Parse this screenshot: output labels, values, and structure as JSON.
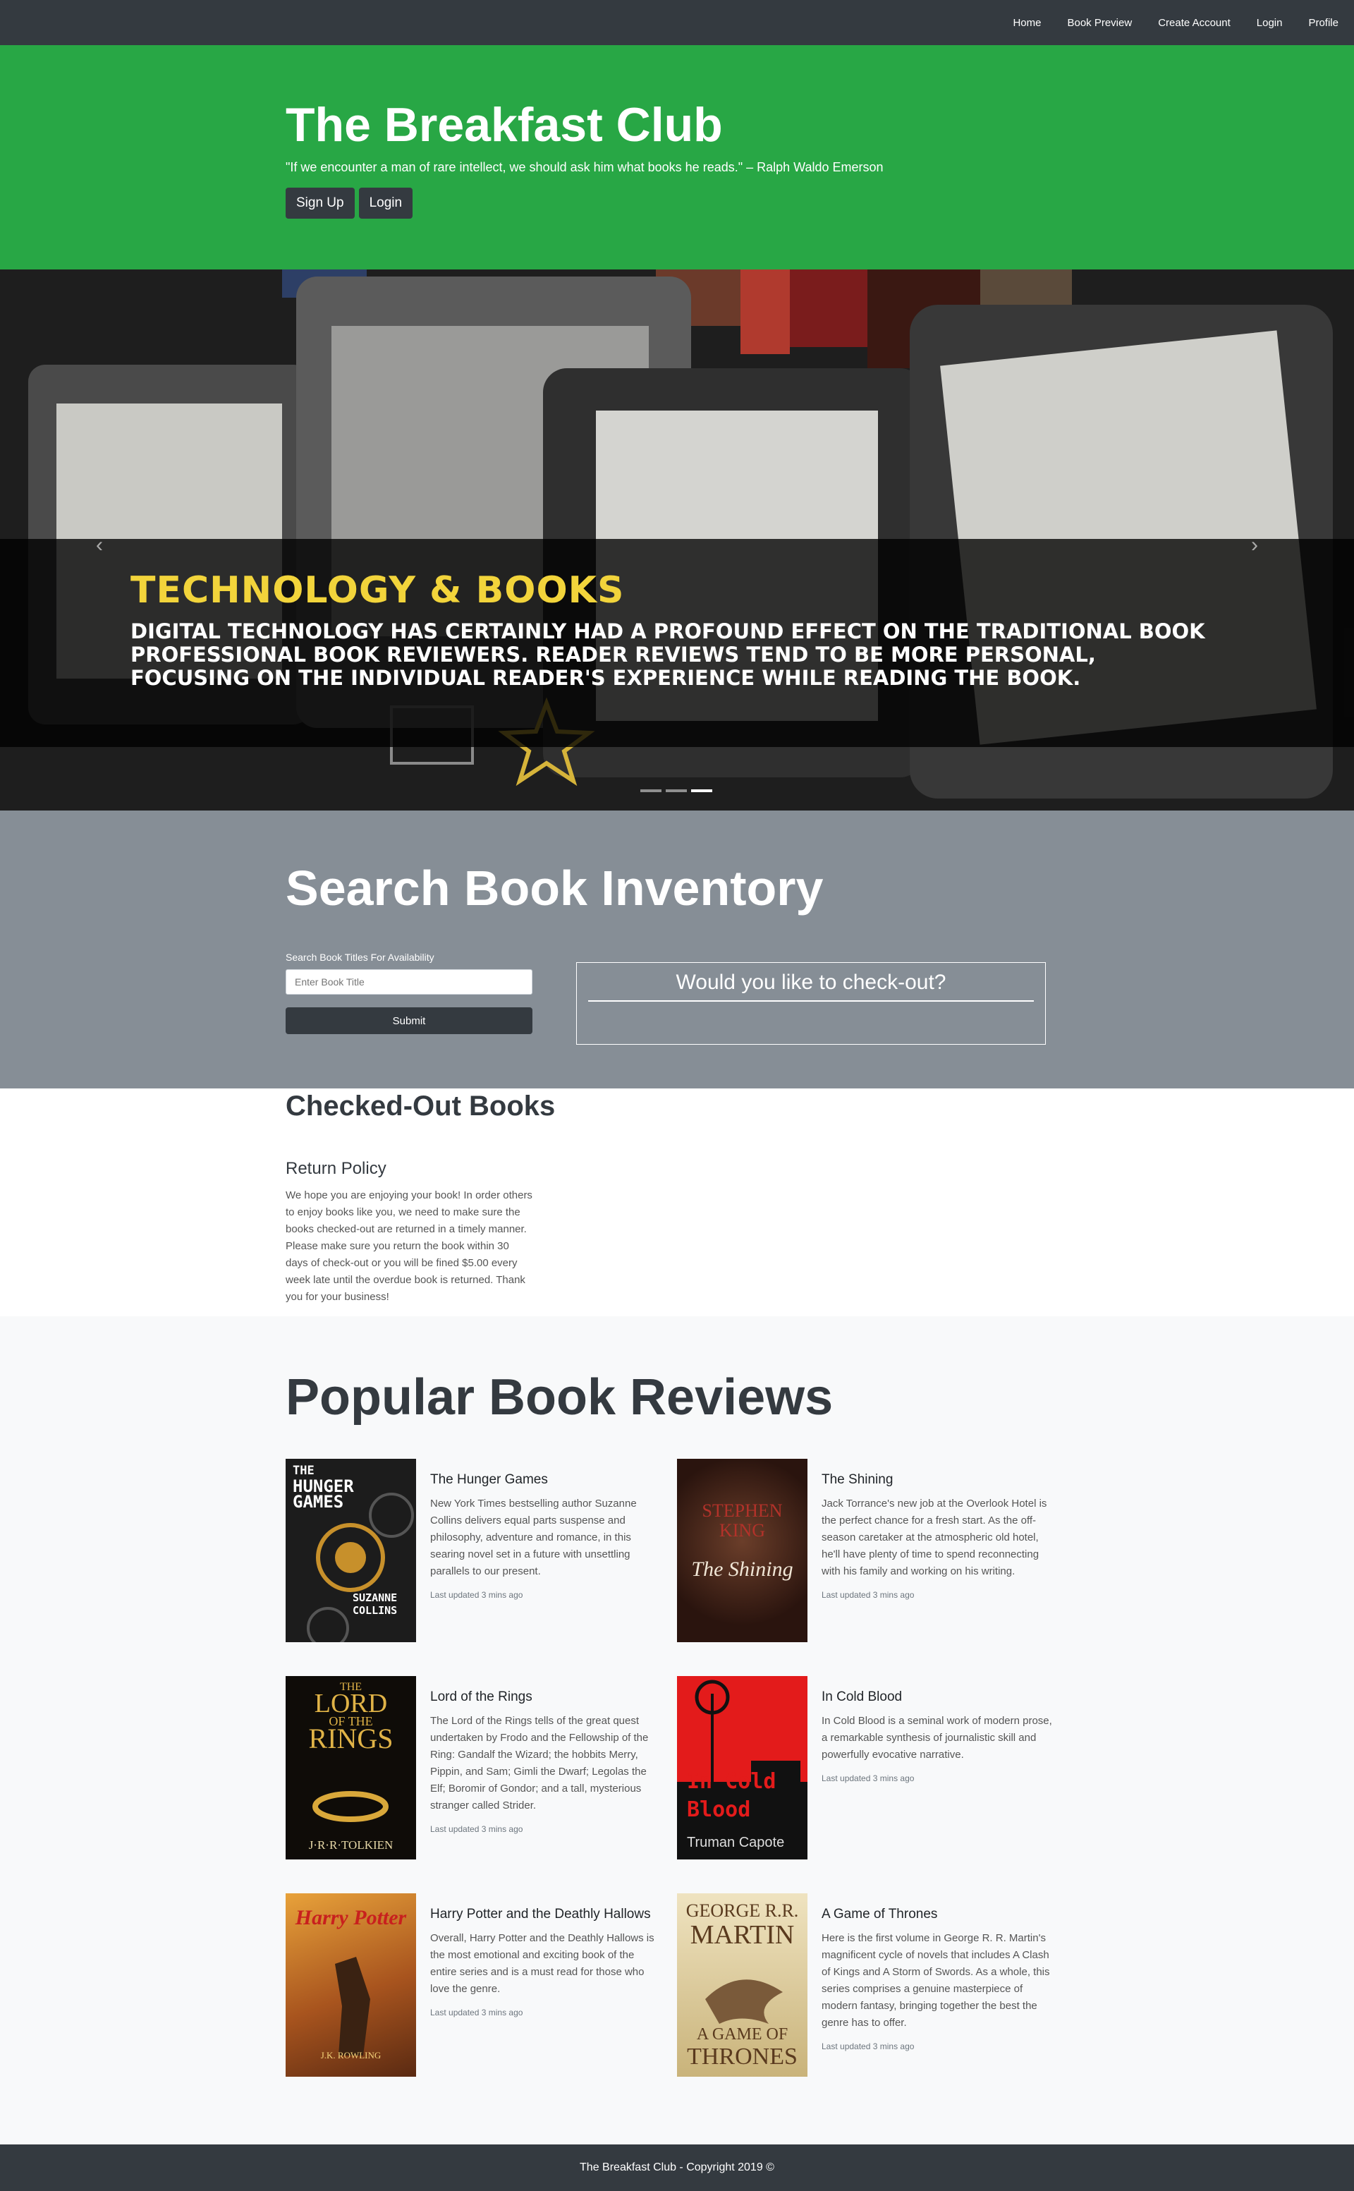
{
  "nav": {
    "items": [
      "Home",
      "Book Preview",
      "Create Account",
      "Login",
      "Profile"
    ]
  },
  "jumbotron": {
    "title": "The Breakfast Club",
    "quote": "\"If we encounter a man of rare intellect, we should ask him what books he reads.\" – Ralph Waldo Emerson",
    "signup_label": "Sign Up",
    "login_label": "Login"
  },
  "carousel": {
    "title": "TECHNOLOGY & BOOKS",
    "text": "Digital technology has certainly had a profound effect on the traditional book professional book reviewers. Reader reviews tend to be more personal, focusing on the individual reader's experience while reading the book.",
    "prev_icon": "chevron-left-icon",
    "next_icon": "chevron-right-icon",
    "slides": 3,
    "active_slide": 3
  },
  "search": {
    "title": "Search Book Inventory",
    "label": "Search Book Titles For Availability",
    "placeholder": "Enter Book Title",
    "submit_label": "Submit",
    "checkout_title": "Would you like to check-out?"
  },
  "checked_out": {
    "title": "Checked-Out Books",
    "policy_title": "Return Policy",
    "policy_text": "We hope you are enjoying your book! In order others to enjoy books like you, we need to make sure the books checked-out are returned in a timely manner. Please make sure you return the book within 30 days of check-out or you will be fined $5.00 every week late until the overdue book is returned. Thank you for your business!"
  },
  "reviews": {
    "title": "Popular Book Reviews",
    "books": [
      {
        "title": "The Hunger Games",
        "description": "New York Times bestselling author Suzanne Collins delivers equal parts suspense and philosophy, adventure and romance, in this searing novel set in a future with unsettling parallels to our present.",
        "updated": "Last updated 3 mins ago",
        "cover_lines": [
          "THE",
          "HUNGER",
          "GAMES",
          "SUZANNE",
          "COLLINS"
        ]
      },
      {
        "title": "The Shining",
        "description": "Jack Torrance's new job at the Overlook Hotel is the perfect chance for a fresh start. As the off-season caretaker at the atmospheric old hotel, he'll have plenty of time to spend reconnecting with his family and working on his writing.",
        "updated": "Last updated 3 mins ago",
        "cover_lines": [
          "STEPHEN",
          "KING",
          "The Shining"
        ]
      },
      {
        "title": "Lord of the Rings",
        "description": "The Lord of the Rings tells of the great quest undertaken by Frodo and the Fellowship of the Ring: Gandalf the Wizard; the hobbits Merry, Pippin, and Sam; Gimli the Dwarf; Legolas the Elf; Boromir of Gondor; and a tall, mysterious stranger called Strider.",
        "updated": "Last updated 3 mins ago",
        "cover_lines": [
          "THE",
          "LORD",
          "OF THE",
          "RINGS",
          "J·R·R·TOLKIEN"
        ]
      },
      {
        "title": "In Cold Blood",
        "description": "In Cold Blood is a seminal work of modern prose, a remarkable synthesis of journalistic skill and powerfully evocative narrative.",
        "updated": "Last updated 3 mins ago",
        "cover_lines": [
          "In Cold",
          "Blood",
          "Truman Capote"
        ]
      },
      {
        "title": "Harry Potter and the Deathly Hallows",
        "description": "Overall, Harry Potter and the Deathly Hallows is the most emotional and exciting book of the entire series and is a must read for those who love the genre.",
        "updated": "Last updated 3 mins ago",
        "cover_lines": [
          "Harry Potter",
          "J.K. ROWLING"
        ]
      },
      {
        "title": "A Game of Thrones",
        "description": "Here is the first volume in George R. R. Martin's magnificent cycle of novels that includes A Clash of Kings and A Storm of Swords. As a whole, this series comprises a genuine masterpiece of modern fantasy, bringing together the best the genre has to offer.",
        "updated": "Last updated 3 mins ago",
        "cover_lines": [
          "GEORGE R.R.",
          "MARTIN",
          "A GAME OF",
          "THRONES"
        ]
      }
    ]
  },
  "footer": {
    "text": "The Breakfast Club - Copyright 2019 ©"
  }
}
